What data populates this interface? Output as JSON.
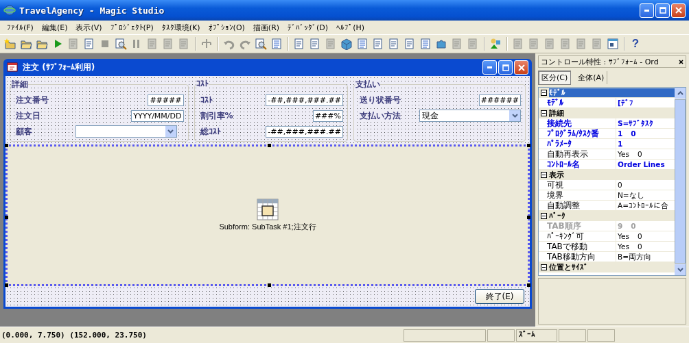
{
  "window": {
    "title": "TravelAgency - Magic Studio"
  },
  "menu": [
    "ﾌｧｲﾙ(F)",
    "編集(E)",
    "表示(V)",
    "ﾌﾟﾛｼﾞｪｸﾄ(P)",
    "ﾀｽｸ環境(K)",
    "ｵﾌﾟｼｮﾝ(O)",
    "描画(R)",
    "ﾃﾞﾊﾞｯｸﾞ(D)",
    "ﾍﾙﾌﾟ(H)"
  ],
  "toolbar": [
    [
      {
        "kind": "new",
        "disabled": false
      },
      {
        "kind": "folder",
        "disabled": false
      },
      {
        "kind": "folder",
        "disabled": false
      },
      {
        "kind": "play",
        "disabled": false
      },
      {
        "kind": "page",
        "disabled": true
      },
      {
        "kind": "page",
        "disabled": false
      },
      {
        "kind": "stop",
        "disabled": true
      },
      {
        "kind": "magnifier",
        "disabled": false
      },
      {
        "kind": "pause",
        "disabled": true
      },
      {
        "kind": "page",
        "disabled": true
      },
      {
        "kind": "page",
        "disabled": true
      },
      {
        "kind": "page",
        "disabled": true
      }
    ],
    [
      {
        "kind": "tree",
        "disabled": true
      }
    ],
    [
      {
        "kind": "undo",
        "disabled": true
      },
      {
        "kind": "redo",
        "disabled": true
      },
      {
        "kind": "magnifier",
        "disabled": false
      },
      {
        "kind": "list",
        "disabled": false
      }
    ],
    [
      {
        "kind": "page",
        "disabled": false
      },
      {
        "kind": "page",
        "disabled": false
      },
      {
        "kind": "page",
        "disabled": true
      },
      {
        "kind": "cube",
        "disabled": false
      },
      {
        "kind": "list",
        "disabled": false
      },
      {
        "kind": "page",
        "disabled": false
      },
      {
        "kind": "page",
        "disabled": false
      },
      {
        "kind": "page",
        "disabled": false
      },
      {
        "kind": "list",
        "disabled": false
      },
      {
        "kind": "puzzle",
        "disabled": false
      },
      {
        "kind": "page",
        "disabled": true
      },
      {
        "kind": "page",
        "disabled": true
      }
    ],
    [
      {
        "kind": "shapes",
        "disabled": false
      }
    ],
    [
      {
        "kind": "page",
        "disabled": true
      },
      {
        "kind": "page",
        "disabled": true
      },
      {
        "kind": "page",
        "disabled": true
      },
      {
        "kind": "page",
        "disabled": true
      },
      {
        "kind": "page",
        "disabled": true
      },
      {
        "kind": "page",
        "disabled": true
      },
      {
        "kind": "window",
        "disabled": false
      }
    ],
    [
      {
        "kind": "help",
        "glyph": "?",
        "disabled": false
      }
    ]
  ],
  "form_window": {
    "title": "注文 (ｻﾌﾞﾌｫｰﾑ利用)",
    "groups": [
      {
        "title": "詳細",
        "fields": [
          {
            "label": "注文番号",
            "kind": "text",
            "value": "#####"
          },
          {
            "label": "注文日",
            "kind": "text",
            "value": "YYYY/MM/DD"
          },
          {
            "label": "顧客",
            "kind": "combo"
          }
        ]
      },
      {
        "title": "ｺｽﾄ",
        "fields": [
          {
            "label": "ｺｽﾄ",
            "kind": "text",
            "value": "-##,###,###.##"
          },
          {
            "label": "割引率%",
            "kind": "text",
            "value": "###%"
          },
          {
            "label": "総ｺｽﾄ",
            "kind": "text",
            "value": "-##,###,###.##"
          }
        ]
      },
      {
        "title": "支払い",
        "fields": [
          {
            "label": "送り状番号",
            "kind": "text",
            "value": "######"
          },
          {
            "label": "支払い方法",
            "kind": "combo",
            "value": "現金"
          }
        ]
      }
    ],
    "subform": {
      "label": "Subform: SubTask #1;注文行"
    },
    "button": "終了(E)"
  },
  "properties": {
    "title": "コントロール特性 : ｻﾌﾞﾌｫｰﾑ - Ord",
    "tabs": [
      {
        "label": "区分(C)",
        "selected": true
      },
      {
        "label": "全体(A)",
        "selected": false
      }
    ],
    "rows": [
      {
        "kind": "group",
        "name": "ﾓﾃﾞﾙ",
        "selected": true
      },
      {
        "kind": "row",
        "name": "ﾓﾃﾞﾙ",
        "value": "[ﾃﾞﾌ",
        "expr": "",
        "changed": true,
        "disabled": false
      },
      {
        "kind": "group",
        "name": "詳細",
        "selected": false
      },
      {
        "kind": "row",
        "name": "接続先",
        "value": "S=ｻﾌﾞﾀｽｸ",
        "expr": "",
        "changed": true,
        "disabled": false
      },
      {
        "kind": "row",
        "name": "ﾌﾟﾛｸﾞﾗﾑ/ﾀｽｸ番",
        "value": "1",
        "expr": "0",
        "changed": true,
        "disabled": false
      },
      {
        "kind": "row",
        "name": "ﾊﾟﾗﾒｰﾀ",
        "value": "1",
        "expr": "",
        "changed": true,
        "disabled": false
      },
      {
        "kind": "row",
        "name": "自動再表示",
        "value": "Yes",
        "expr": "0",
        "changed": false,
        "disabled": false
      },
      {
        "kind": "row",
        "name": "ｺﾝﾄﾛｰﾙ名",
        "value": "Order Lines",
        "expr": "",
        "changed": true,
        "disabled": false
      },
      {
        "kind": "group",
        "name": "表示",
        "selected": false
      },
      {
        "kind": "row",
        "name": "可視",
        "value": "",
        "expr": "0",
        "changed": false,
        "disabled": false
      },
      {
        "kind": "row",
        "name": "境界",
        "value": "N=なし",
        "expr": "",
        "changed": false,
        "disabled": false
      },
      {
        "kind": "row",
        "name": "自動調整",
        "value": "A=ｺﾝﾄﾛｰﾙに合",
        "expr": "",
        "changed": false,
        "disabled": false
      },
      {
        "kind": "group",
        "name": "ﾊﾟｰｸ",
        "selected": false
      },
      {
        "kind": "row",
        "name": "TAB順序",
        "value": "9",
        "expr": "0",
        "changed": false,
        "disabled": true
      },
      {
        "kind": "row",
        "name": "ﾊﾟｰｷﾝｸﾞ可",
        "value": "Yes",
        "expr": "0",
        "changed": false,
        "disabled": false
      },
      {
        "kind": "row",
        "name": "TABで移動",
        "value": "Yes",
        "expr": "0",
        "changed": false,
        "disabled": false
      },
      {
        "kind": "row",
        "name": "TAB移動方向",
        "value": "B=両方向",
        "expr": "",
        "changed": false,
        "disabled": false
      },
      {
        "kind": "group",
        "name": "位置とｻｲｽﾞ",
        "selected": false
      }
    ]
  },
  "status_bar": {
    "coordinates": "(0.000, 7.750)  (152.000, 23.750)",
    "zoom": "ｽﾞｰﾑ"
  }
}
